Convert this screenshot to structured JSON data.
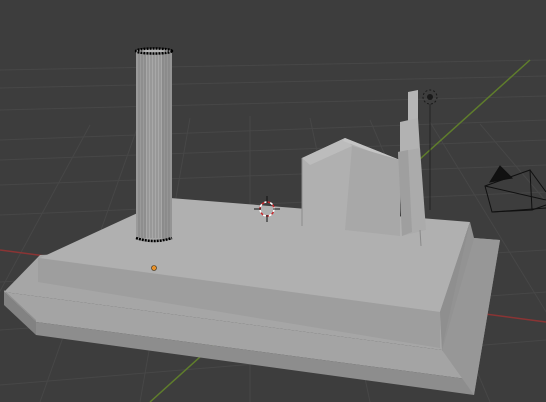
{
  "editor": "3d-viewport",
  "view": "perspective",
  "colors": {
    "background": "#3d3d3d",
    "grid_line": "#464646",
    "x_axis": "#8a3434",
    "y_axis": "#5f7d2c",
    "mesh_face_light": "#aeaeae",
    "mesh_face_mid": "#9c9c9c",
    "mesh_face_dark": "#8a8a8a",
    "selected_edge": "#000000",
    "origin_dot": "#e8912a",
    "cursor_red": "#c8282d",
    "camera_wire": "#000000"
  },
  "objects": [
    "base-platform",
    "column",
    "house",
    "tower",
    "camera",
    "light",
    "3d-cursor",
    "origin-point"
  ]
}
